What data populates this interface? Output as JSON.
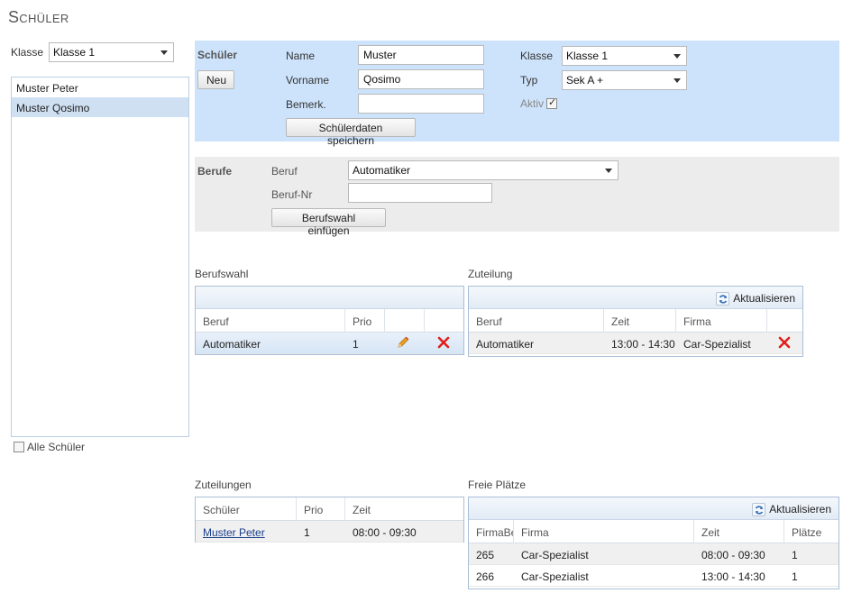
{
  "page": {
    "title": "Schüler"
  },
  "klasse_filter": {
    "label": "Klasse",
    "value": "Klasse 1"
  },
  "students": [
    "Muster Peter",
    "Muster Qosimo"
  ],
  "alle_schueler": {
    "label": "Alle Schüler",
    "checked": false
  },
  "schueler_form": {
    "section": "Schüler",
    "new_button": "Neu",
    "name_label": "Name",
    "name_value": "Muster",
    "vorname_label": "Vorname",
    "vorname_value": "Qosimo",
    "bemerk_label": "Bemerk.",
    "bemerk_value": "",
    "save_button": "Schülerdaten speichern",
    "klasse_label": "Klasse",
    "klasse_value": "Klasse 1",
    "typ_label": "Typ",
    "typ_value": "Sek A +",
    "aktiv_label": "Aktiv",
    "aktiv_checked": true
  },
  "berufe_form": {
    "section": "Berufe",
    "beruf_label": "Beruf",
    "beruf_value": "Automatiker",
    "berufnr_label": "Beruf-Nr",
    "berufnr_value": "",
    "insert_button": "Berufswahl einfügen"
  },
  "berufswahl": {
    "title": "Berufswahl",
    "headers": [
      "Beruf",
      "Prio"
    ],
    "rows": [
      {
        "beruf": "Automatiker",
        "prio": "1"
      }
    ]
  },
  "zuteilung": {
    "title": "Zuteilung",
    "refresh": "Aktualisieren",
    "headers": [
      "Beruf",
      "Zeit",
      "Firma"
    ],
    "rows": [
      {
        "beruf": "Automatiker",
        "zeit": "13:00 - 14:30",
        "firma": "Car-Spezialist"
      }
    ]
  },
  "zuteilungen": {
    "title": "Zuteilungen",
    "headers": [
      "Schüler",
      "Prio",
      "Zeit"
    ],
    "rows": [
      {
        "schueler": "Muster Peter",
        "prio": "1",
        "zeit": "08:00 - 09:30"
      }
    ]
  },
  "freie_plaetze": {
    "title": "Freie Plätze",
    "refresh": "Aktualisieren",
    "headers": [
      "FirmaBe",
      "Firma",
      "Zeit",
      "Plätze"
    ],
    "rows": [
      {
        "id": "265",
        "firma": "Car-Spezialist",
        "zeit": "08:00 - 09:30",
        "plaetze": "1"
      },
      {
        "id": "266",
        "firma": "Car-Spezialist",
        "zeit": "13:00 - 14:30",
        "plaetze": "1"
      }
    ]
  },
  "colors": {
    "panel_blue": "#cde3fb",
    "panel_grey": "#ececec",
    "selection": "#cfe0f3",
    "delete_red": "#e0201c"
  }
}
